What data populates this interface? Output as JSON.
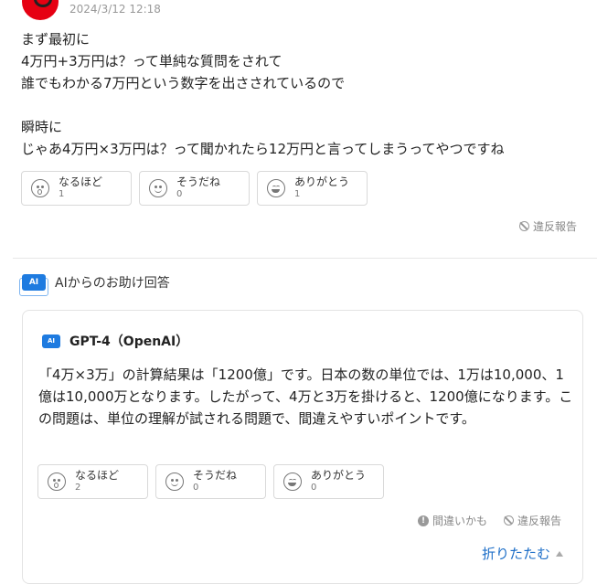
{
  "answer": {
    "timestamp": "2024/3/12 12:18",
    "text": "まず最初に\n4万円+3万円は？って単純な質問をされて\n誰でもわかる7万円という数字を出さされているので\n\n瞬時に\nじゃあ4万円×3万円は？って聞かれたら12万円と言ってしまうってやつですね",
    "reactions": [
      {
        "label": "なるほど",
        "count": "1",
        "icon": "surprised-face-icon"
      },
      {
        "label": "そうだね",
        "count": "0",
        "icon": "smile-face-icon"
      },
      {
        "label": "ありがとう",
        "count": "1",
        "icon": "grin-face-icon"
      }
    ],
    "report_label": "違反報告"
  },
  "ai_section": {
    "header": "AIからのお助け回答",
    "badge": "AI",
    "model": "GPT-4（OpenAI）",
    "text": "「4万×3万」の計算結果は「1200億」です。日本の数の単位では、1万は10,000、1億は10,000万となります。したがって、4万と3万を掛けると、1200億になります。この問題は、単位の理解が試される問題で、間違えやすいポイントです。",
    "reactions": [
      {
        "label": "なるほど",
        "count": "2",
        "icon": "surprised-face-icon"
      },
      {
        "label": "そうだね",
        "count": "0",
        "icon": "smile-face-icon"
      },
      {
        "label": "ありがとう",
        "count": "0",
        "icon": "grin-face-icon"
      }
    ],
    "mistake_label": "間違いかも",
    "report_label": "違反報告",
    "collapse_label": "折りたたむ"
  },
  "colors": {
    "accent": "#1e7be0",
    "link": "#1e6fc8",
    "avatar": "#e60012"
  }
}
